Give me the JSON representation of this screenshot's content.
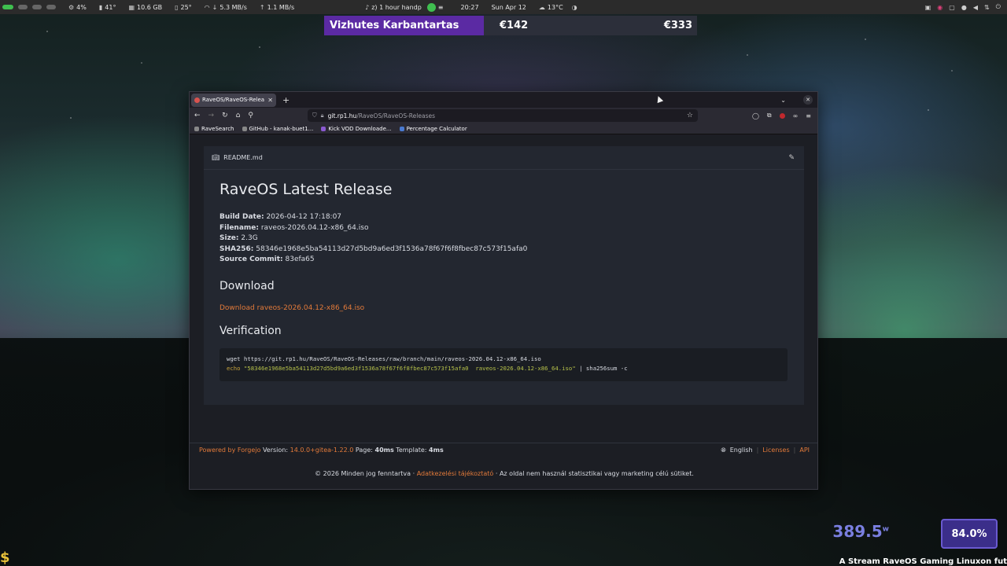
{
  "topbar": {
    "cpu": "4%",
    "temp": "41°",
    "mem": "10.6 GB",
    "gpu_temp": "25°",
    "down": "5.3 MB/s",
    "up": "1.1 MB/s",
    "media": "z) 1 hour handp",
    "media_extra": "≡",
    "time": "20:27",
    "date": "Sun Apr 12",
    "weather": "13°C"
  },
  "banner": {
    "name": "Vizhutes Karbantartas",
    "price1": "€142",
    "price2": "€333"
  },
  "browser": {
    "tab_title": "RaveOS/RaveOS-Relea",
    "url_host": "git.rp1.hu",
    "url_path": "/RaveOS/RaveOS-Releases",
    "bookmarks": [
      {
        "label": "RaveSearch"
      },
      {
        "label": "GitHub - kanak-buet1..."
      },
      {
        "label": "Kick VOD Downloade..."
      },
      {
        "label": "Percentage Calculator"
      }
    ]
  },
  "readme": {
    "filename": "README.md",
    "title": "RaveOS Latest Release",
    "build_date_label": "Build Date:",
    "build_date": "2026-04-12 17:18:07",
    "filename_label": "Filename:",
    "file": "raveos-2026.04.12-x86_64.iso",
    "size_label": "Size:",
    "size": "2.3G",
    "sha_label": "SHA256:",
    "sha": "58346e1968e5ba54113d27d5bd9a6ed3f1536a78f67f6f8fbec87c573f15afa0",
    "commit_label": "Source Commit:",
    "commit": "83efa65",
    "download_heading": "Download",
    "download_link": "Download raveos-2026.04.12-x86_64.iso",
    "verification_heading": "Verification",
    "code_line1": "wget https://git.rp1.hu/RaveOS/RaveOS-Releases/raw/branch/main/raveos-2026.04.12-x86_64.iso",
    "code_echo": "echo",
    "code_str": "\"58346e1968e5ba54113d27d5bd9a6ed3f1536a78f67f6f8fbec87c573f15afa0  raveos-2026.04.12-x86_64.iso\"",
    "code_tail": " | sha256sum -c"
  },
  "footer": {
    "powered": "Powered by Forgejo",
    "version_label": "Version:",
    "version": "14.0.0+gitea-1.22.0",
    "page_label": "Page:",
    "page_time": "40ms",
    "template_label": "Template:",
    "template_time": "4ms",
    "language": "English",
    "licenses": "Licenses",
    "api": "API",
    "copyright": "© 2026 Minden jog fenntartva ·",
    "privacy": "Adatkezelési tájékoztató",
    "note": "· Az oldal nem használ statisztikai vagy marketing célú sütiket."
  },
  "overlay": {
    "watts": "389.5",
    "watts_unit": "w",
    "percent": "84.0%",
    "ticker": "A Stream RaveOS Gaming Linuxon fut",
    "dollar": "$"
  }
}
